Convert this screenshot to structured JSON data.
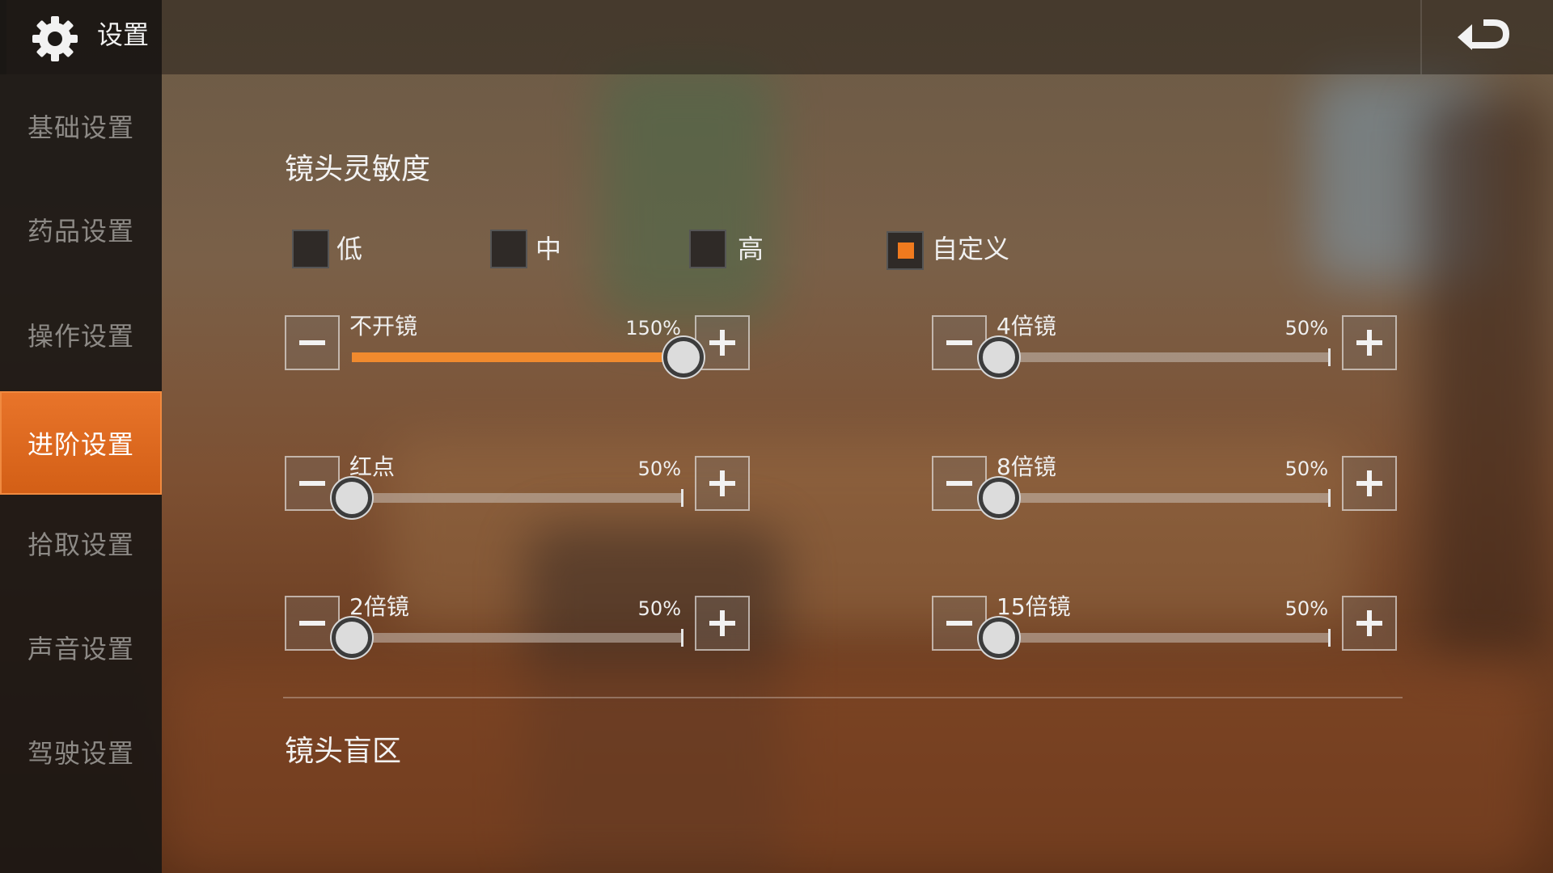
{
  "header": {
    "title": "设置",
    "icon": "gear-icon",
    "back_icon": "back-arrow-icon"
  },
  "sidebar": {
    "items": [
      {
        "label": "基础设置"
      },
      {
        "label": "药品设置"
      },
      {
        "label": "操作设置"
      },
      {
        "label": "进阶设置",
        "active": true
      },
      {
        "label": "拾取设置"
      },
      {
        "label": "声音设置"
      },
      {
        "label": "驾驶设置"
      }
    ]
  },
  "sensitivity": {
    "title": "镜头灵敏度",
    "presets": [
      {
        "label": "低",
        "checked": false
      },
      {
        "label": "中",
        "checked": false
      },
      {
        "label": "高",
        "checked": false
      },
      {
        "label": "自定义",
        "checked": true
      }
    ],
    "sliders": [
      {
        "label": "不开镜",
        "value": "150%",
        "level": 1.0
      },
      {
        "label": "4倍镜",
        "value": "50%",
        "level": 0.0
      },
      {
        "label": "红点",
        "value": "50%",
        "level": 0.0
      },
      {
        "label": "8倍镜",
        "value": "50%",
        "level": 0.0
      },
      {
        "label": "2倍镜",
        "value": "50%",
        "level": 0.0
      },
      {
        "label": "15倍镜",
        "value": "50%",
        "level": 0.0
      }
    ]
  },
  "blind_zone": {
    "title": "镜头盲区"
  },
  "colors": {
    "accent": "#e8742a",
    "checked": "#f07a1e"
  }
}
